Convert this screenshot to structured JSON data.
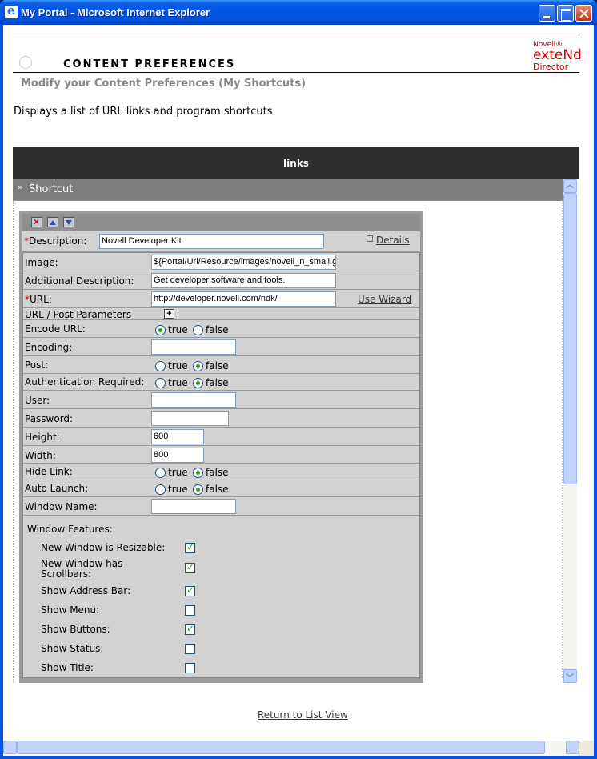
{
  "window": {
    "title": "My Portal - Microsoft Internet Explorer"
  },
  "header": {
    "title": "CONTENT PREFERENCES",
    "logo": {
      "line1": "Novell®",
      "line2": "exteNd",
      "line3": "Director"
    }
  },
  "subtitle": "Modify your Content Preferences (My Shortcuts)",
  "description": "Displays a list of URL links and program shortcuts",
  "links_bar": "links",
  "shortcut_bar": "Shortcut",
  "form": {
    "description_label": "Description:",
    "description_value": "Novell Developer Kit",
    "details_link": "Details",
    "use_wizard": "Use Wizard",
    "true_label": "true",
    "false_label": "false",
    "fields": {
      "image": {
        "label": "Image:",
        "value": "${Portal/Url/Resource/images/novell_n_small.gif"
      },
      "additional": {
        "label": "Additional Description:",
        "value": "Get developer software and tools."
      },
      "url": {
        "label": "URL:",
        "value": "http://developer.novell.com/ndk/"
      },
      "params": {
        "label": "URL / Post Parameters"
      },
      "encode": {
        "label": "Encode URL:",
        "selected": "true"
      },
      "encoding": {
        "label": "Encoding:",
        "value": ""
      },
      "post": {
        "label": "Post:",
        "selected": "false"
      },
      "auth": {
        "label": "Authentication Required:",
        "selected": "false"
      },
      "user": {
        "label": "User:",
        "value": ""
      },
      "password": {
        "label": "Password:",
        "value": ""
      },
      "height": {
        "label": "Height:",
        "value": "600"
      },
      "width": {
        "label": "Width:",
        "value": "800"
      },
      "hide_link": {
        "label": "Hide Link:",
        "selected": "false"
      },
      "auto_launch": {
        "label": "Auto Launch:",
        "selected": "false"
      },
      "window_name": {
        "label": "Window Name:",
        "value": ""
      }
    },
    "window_features_label": "Window Features:",
    "features": [
      {
        "label": "New Window is Resizable:",
        "checked": true
      },
      {
        "label": "New Window has Scrollbars:",
        "checked": true
      },
      {
        "label": "Show Address Bar:",
        "checked": true
      },
      {
        "label": "Show Menu:",
        "checked": false
      },
      {
        "label": "Show Buttons:",
        "checked": true
      },
      {
        "label": "Show Status:",
        "checked": false
      },
      {
        "label": "Show Title:",
        "checked": false
      }
    ]
  },
  "return_link": "Return to List View"
}
